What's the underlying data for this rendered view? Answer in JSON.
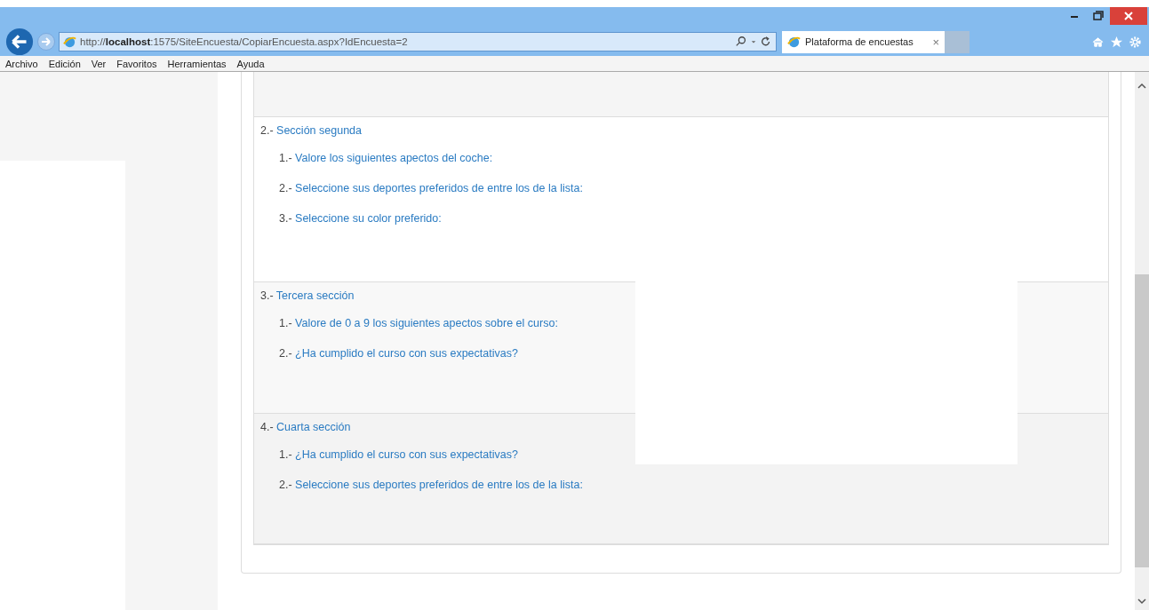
{
  "browser": {
    "address_prefix": "http://",
    "address_host": "localhost",
    "address_rest": ":1575/SiteEncuesta/CopiarEncuesta.aspx?IdEncuesta=2",
    "tab": {
      "title": "Plataforma de encuestas",
      "close": "×",
      "selected": true
    }
  },
  "menu": [
    "Archivo",
    "Edición",
    "Ver",
    "Favoritos",
    "Herramientas",
    "Ayuda"
  ],
  "sections": [
    {
      "number": "2.-",
      "title": "Sección segunda",
      "questions": [
        {
          "number": "1.-",
          "text": "Valore los siguientes apectos del coche:"
        },
        {
          "number": "2.-",
          "text": "Seleccione sus deportes preferidos de entre los de la lista:"
        },
        {
          "number": "3.-",
          "text": "Seleccione su color preferido:"
        }
      ]
    },
    {
      "number": "3.-",
      "title": "Tercera sección",
      "questions": [
        {
          "number": "1.-",
          "text": "Valore de 0 a 9 los siguientes apectos sobre el curso:"
        },
        {
          "number": "2.-",
          "text": "¿Ha cumplido el curso con sus expectativas?"
        }
      ]
    },
    {
      "number": "4.-",
      "title": "Cuarta sección",
      "questions": [
        {
          "number": "1.-",
          "text": "¿Ha cumplido el curso con sus expectativas?"
        },
        {
          "number": "2.-",
          "text": "Seleccione sus deportes preferidos de entre los de la lista:"
        }
      ]
    }
  ]
}
